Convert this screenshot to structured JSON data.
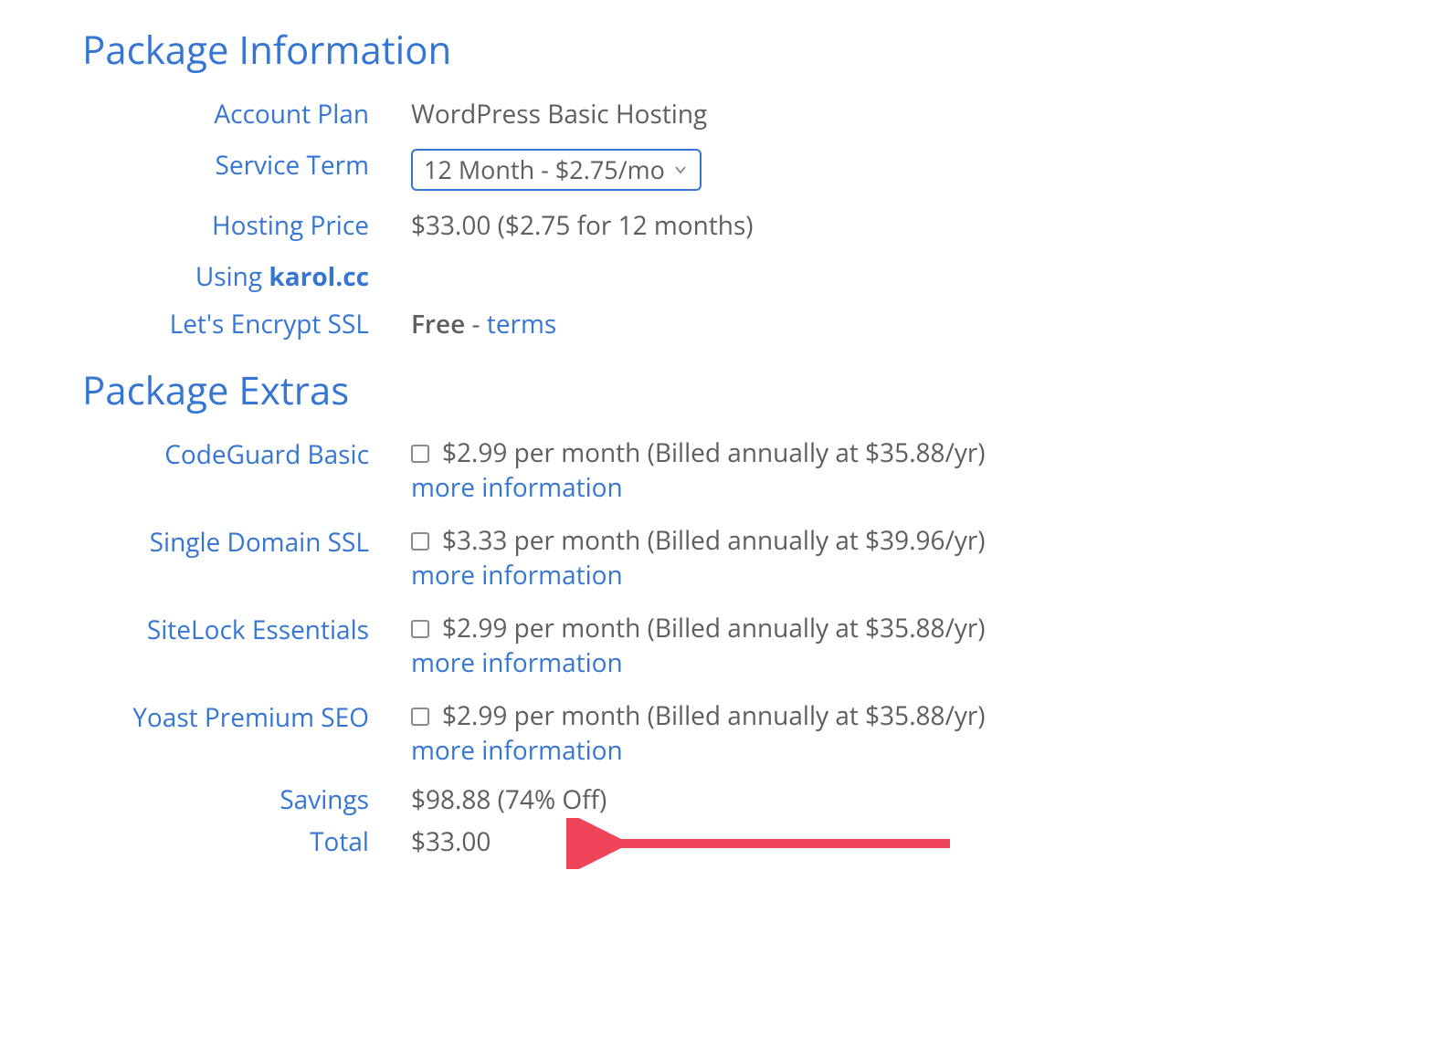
{
  "sections": {
    "package_info_heading": "Package Information",
    "package_extras_heading": "Package Extras"
  },
  "info": {
    "account_plan_label": "Account Plan",
    "account_plan_value": "WordPress Basic Hosting",
    "service_term_label": "Service Term",
    "service_term_selected": "12 Month - $2.75/mo",
    "hosting_price_label": "Hosting Price",
    "hosting_price_value": "$33.00 ($2.75 for 12 months)",
    "using_label_prefix": "Using ",
    "using_domain": "karol.cc",
    "ssl_label": "Let's Encrypt SSL",
    "ssl_free": "Free",
    "ssl_sep": " - ",
    "ssl_terms": "terms"
  },
  "extras": [
    {
      "name": "CodeGuard Basic",
      "price": "$2.99 per month (Billed annually at $35.88/yr)",
      "more": "more information"
    },
    {
      "name": "Single Domain SSL",
      "price": "$3.33 per month (Billed annually at $39.96/yr)",
      "more": "more information"
    },
    {
      "name": "SiteLock Essentials",
      "price": "$2.99 per month (Billed annually at $35.88/yr)",
      "more": "more information"
    },
    {
      "name": "Yoast Premium SEO",
      "price": "$2.99 per month (Billed annually at $35.88/yr)",
      "more": "more information"
    }
  ],
  "summary": {
    "savings_label": "Savings",
    "savings_value": "$98.88 (74% Off)",
    "total_label": "Total",
    "total_value": "$33.00"
  }
}
